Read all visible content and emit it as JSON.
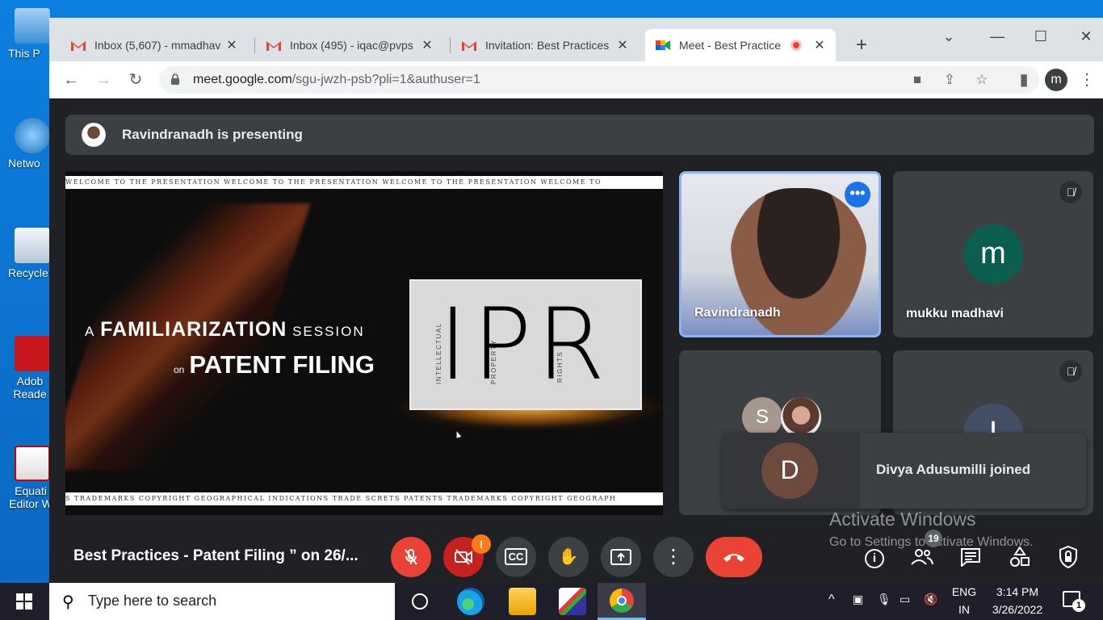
{
  "desktop": {
    "icons": [
      "This P",
      "Netwo",
      "Recycle",
      "Adob Reade",
      "Equati Editor W"
    ]
  },
  "browser": {
    "tabs": [
      {
        "title": "Inbox (5,607) - mmadhav",
        "icon": "gmail-icon"
      },
      {
        "title": "Inbox (495) - iqac@pvps",
        "icon": "gmail-icon"
      },
      {
        "title": "Invitation: Best Practices",
        "icon": "gmail-icon"
      },
      {
        "title": "Meet - Best Practice",
        "icon": "meet-icon",
        "active": true
      }
    ],
    "url_host": "meet.google.com",
    "url_path": "/sgu-jwzh-psb?pli=1&authuser=1",
    "profile_initial": "m"
  },
  "meet": {
    "presenting_text": "Ravindranadh is presenting",
    "slide": {
      "banner_top": "WELCOME TO THE PRESENTATION            WELCOME TO THE PRESENTATION            WELCOME TO THE PRESENTATION            WELCOME TO",
      "banner_bottom": "S   TRADEMARKS   COPYRIGHT     GEOGRAPHICAL INDICATIONS   TRADE SCRETS     PATENTS   TRADEMARKS   COPYRIGHT    GEOGRAPH",
      "title_a": "A",
      "title_main": "FAMILIARIZATION",
      "title_session": "SESSION",
      "title_on": "on",
      "title_sub": "PATENT FILING",
      "ipr": "IPR",
      "vert_1": "INTELLECTUAL",
      "vert_2": "PROPERTY",
      "vert_3": "RIGHTS"
    },
    "participants": [
      {
        "name": "Ravindranadh",
        "type": "video"
      },
      {
        "name": "mukku madhavi",
        "initial": "m",
        "color": "#0b5e4f"
      },
      {
        "initial": "S",
        "color": "#a7988f"
      },
      {
        "initial": "I",
        "color": "#425066"
      }
    ],
    "toast": {
      "initial": "D",
      "text": "Divya Adusumilli joined",
      "color": "#6e4a3c"
    },
    "meeting_title": "Best Practices - Patent Filing ” on 26/...",
    "people_count": "19",
    "activate_title": "Activate Windows",
    "activate_sub": "Go to Settings to activate Windows."
  },
  "taskbar": {
    "search_placeholder": "Type here to search",
    "lang_top": "ENG",
    "lang_bottom": "IN",
    "time": "3:14 PM",
    "date": "3/26/2022",
    "notification_count": "1"
  }
}
